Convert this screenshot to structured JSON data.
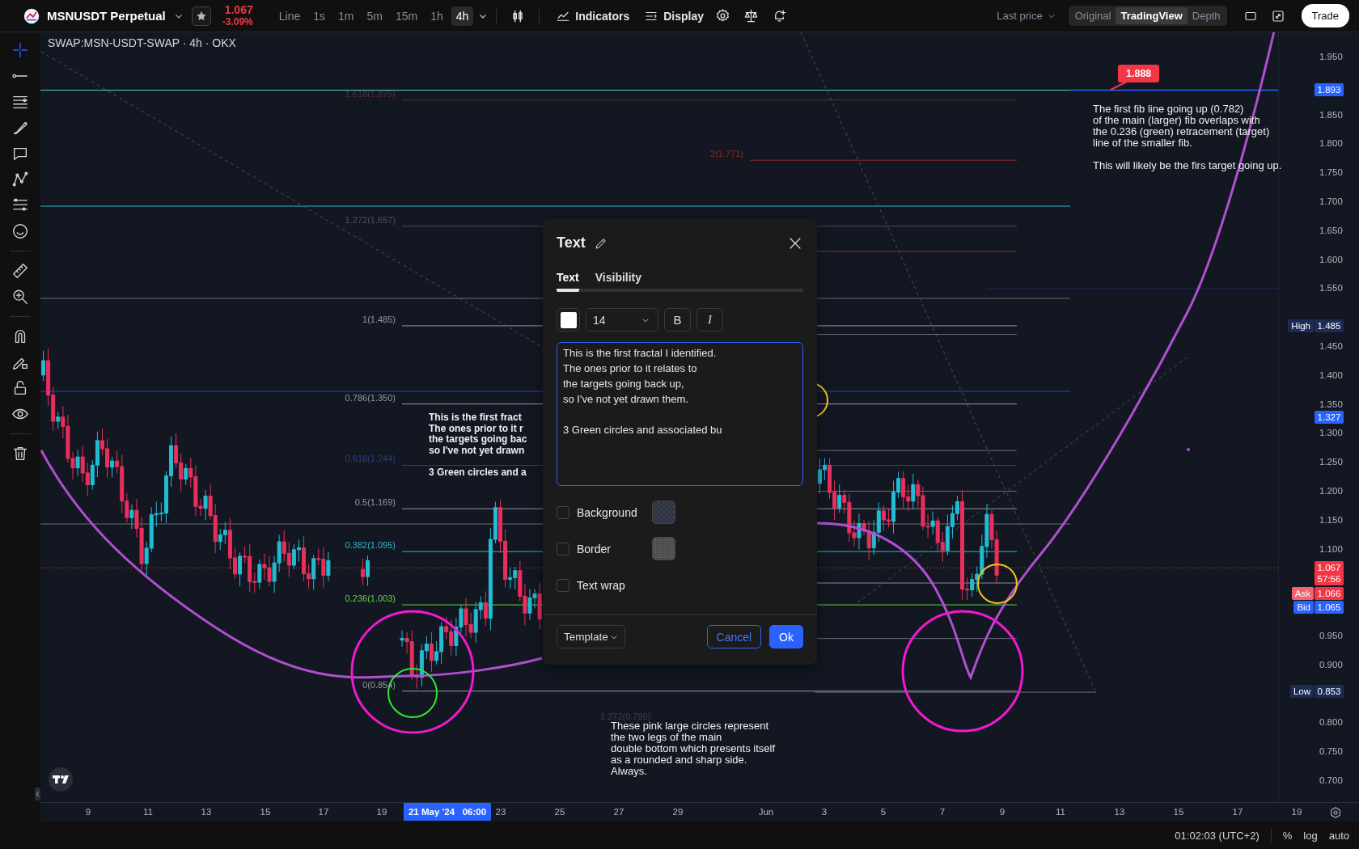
{
  "header": {
    "symbol": "MSNUSDT Perpetual",
    "last_price": "1.067",
    "change": "-3.09%",
    "intervals": [
      {
        "label": "Line",
        "selected": false
      },
      {
        "label": "1s",
        "selected": false
      },
      {
        "label": "1m",
        "selected": false
      },
      {
        "label": "5m",
        "selected": false
      },
      {
        "label": "15m",
        "selected": false
      },
      {
        "label": "1h",
        "selected": false
      },
      {
        "label": "4h",
        "selected": true
      }
    ],
    "buttons": [
      "Indicators",
      "Display"
    ],
    "price_source": "Last price",
    "views": [
      {
        "label": "Original",
        "selected": false
      },
      {
        "label": "TradingView",
        "selected": true
      },
      {
        "label": "Depth",
        "selected": false
      }
    ],
    "trade": "Trade"
  },
  "toolbar": {
    "tools": [
      {
        "selected": true
      },
      {
        "selected": false
      },
      {
        "selected": false
      },
      {
        "selected": false
      },
      {
        "selected": false
      },
      {
        "selected": false
      },
      {
        "selected": false
      },
      {
        "selected": false
      },
      {
        "selected": false
      },
      {
        "selected": false
      },
      {
        "selected": false
      },
      {
        "selected": false
      },
      {
        "selected": false
      },
      {
        "selected": false
      },
      {
        "selected": false
      }
    ]
  },
  "chart": {
    "symbol_label": "SWAP:MSN-USDT-SWAP · 4h · OKX",
    "price_ticks": [
      "1.950",
      "1.850",
      "1.800",
      "1.750",
      "1.700",
      "1.650",
      "1.600",
      "1.550",
      "1.450",
      "1.400",
      "1.350",
      "1.300",
      "1.250",
      "1.200",
      "1.150",
      "1.100",
      "0.950",
      "0.900",
      "0.800",
      "0.750",
      "0.700"
    ],
    "price_badges": [
      {
        "kind": "line",
        "value": "1.893"
      },
      {
        "kind": "high",
        "label": "High",
        "value": "1.485"
      },
      {
        "kind": "line",
        "value": "1.327"
      },
      {
        "kind": "last",
        "value": "1.067",
        "countdown": "57:56"
      },
      {
        "kind": "ask",
        "label": "Ask",
        "value": "1.066"
      },
      {
        "kind": "bid",
        "label": "Bid",
        "value": "1.065"
      },
      {
        "kind": "low",
        "label": "Low",
        "value": "0.853"
      }
    ],
    "fib_levels": [
      {
        "label": "1.618(1.875)",
        "color": "#5a2f3d"
      },
      {
        "label": "2(1.771)",
        "color": "#8c2a2a"
      },
      {
        "label": "1.272(1.657)",
        "color": "#4a4f5c"
      },
      {
        "label": "1(1.485)",
        "color": "#9598a1"
      },
      {
        "label": "0.786(1.350)",
        "color": "#9598a1"
      },
      {
        "label": "0.618(1.244)",
        "color": "#2b3f86"
      },
      {
        "label": "0.5(1.169)",
        "color": "#9598a1"
      },
      {
        "label": "0.382(1.095)",
        "color": "#2fb6d4"
      },
      {
        "label": "0.236(1.003)",
        "color": "#5ed63a"
      },
      {
        "label": "0(0.854)",
        "color": "#9598a1"
      },
      {
        "label": "1.272(0.799)",
        "color": "#3c414d"
      }
    ],
    "annotations": [
      {
        "text": "This is the first fract\nThe ones prior to it r\nthe targets going bac\nso I've not yet drawn\n\n3 Green circles and a"
      },
      {
        "text": "These pink large circles represent\nthe two legs of the main\ndouble bottom which presents itself\nas a rounded and sharp side.\nAlways."
      },
      {
        "text": "The first fib line going up (0.782)\nof the main (larger) fib overlaps with\nthe 0.236 (green) retracement (target)\nline of the smaller fib.\n\nThis will likely be the firs target going up."
      }
    ],
    "callout": "1.888"
  },
  "dialog": {
    "title": "Text",
    "tabs": [
      {
        "label": "Text",
        "selected": true
      },
      {
        "label": "Visibility",
        "selected": false
      }
    ],
    "font_size": "14",
    "bold": "B",
    "italic": "I",
    "text": "This is the first fractal I identified.\nThe ones prior to it relates to\nthe targets going back up,\nso I've not yet drawn them.\n\n3 Green circles and associated bu",
    "options": [
      {
        "label": "Background",
        "checked": false,
        "kind": "swatch"
      },
      {
        "label": "Border",
        "checked": false,
        "kind": "swatch"
      },
      {
        "label": "Text wrap",
        "checked": false,
        "kind": "plain"
      }
    ],
    "template": "Template",
    "buttons": [
      {
        "label": "Cancel",
        "kind": "secondary"
      },
      {
        "label": "Ok",
        "kind": "primary"
      }
    ]
  },
  "time_axis": {
    "ticks": [
      {
        "label": "9",
        "selected": false
      },
      {
        "label": "11",
        "selected": false
      },
      {
        "label": "13",
        "selected": false
      },
      {
        "label": "15",
        "selected": false
      },
      {
        "label": "17",
        "selected": false
      },
      {
        "label": "19",
        "selected": false
      },
      {
        "label": "21 May '24   06:00",
        "selected": true
      },
      {
        "label": "23",
        "selected": false
      },
      {
        "label": "25",
        "selected": false
      },
      {
        "label": "27",
        "selected": false
      },
      {
        "label": "29",
        "selected": false
      },
      {
        "label": "Jun",
        "selected": false
      },
      {
        "label": "3",
        "selected": false
      },
      {
        "label": "5",
        "selected": false
      },
      {
        "label": "7",
        "selected": false
      },
      {
        "label": "9",
        "selected": false
      },
      {
        "label": "11",
        "selected": false
      },
      {
        "label": "13",
        "selected": false
      },
      {
        "label": "15",
        "selected": false
      },
      {
        "label": "17",
        "selected": false
      },
      {
        "label": "19",
        "selected": false
      }
    ]
  },
  "status_bar": {
    "time": "01:02:03 (UTC+2)",
    "options": [
      "%",
      "log",
      "auto"
    ]
  }
}
